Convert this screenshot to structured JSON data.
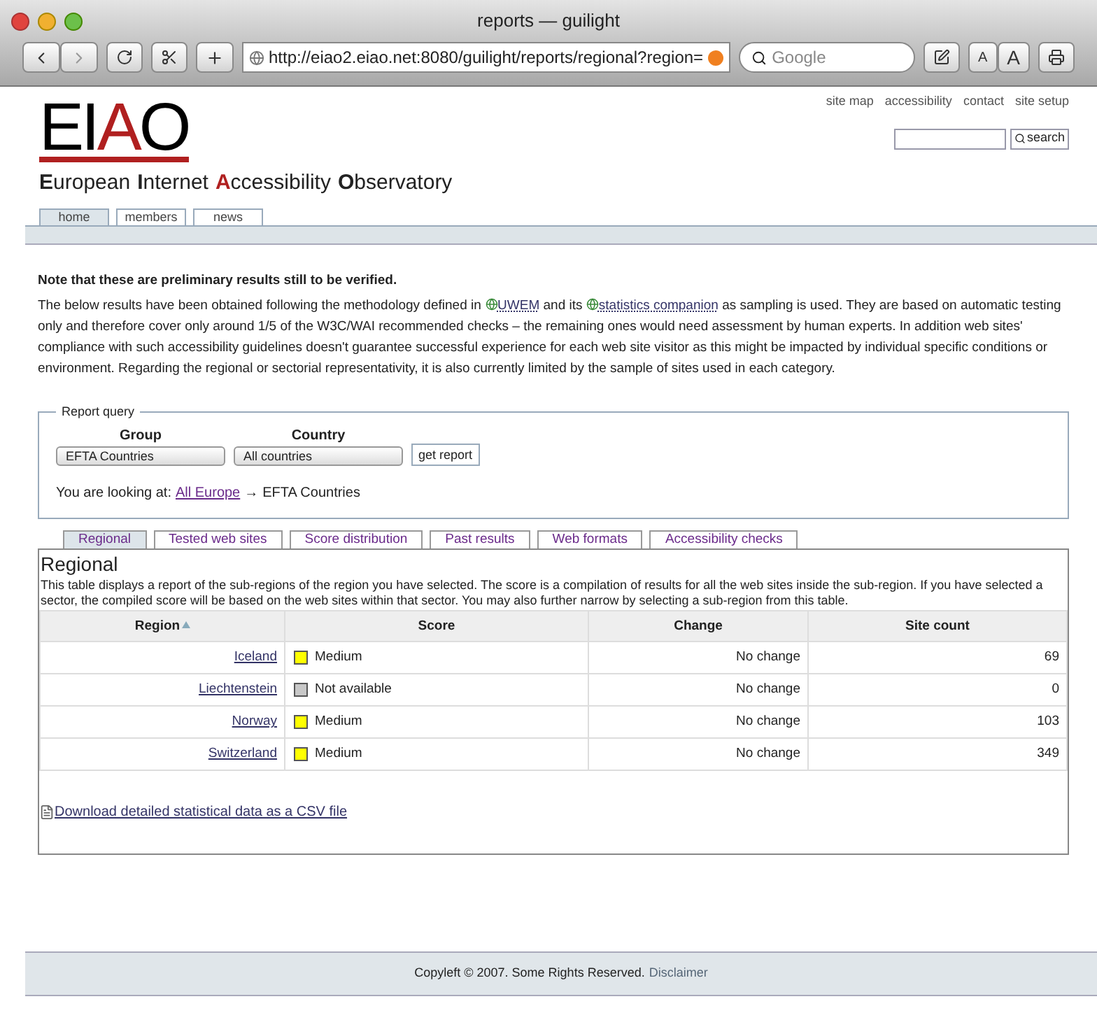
{
  "window": {
    "title": "reports — guilight",
    "url": "http://eiao2.eiao.net:8080/guilight/reports/regional?region=",
    "search_placeholder": "Google",
    "font_buttons": [
      "A",
      "A"
    ]
  },
  "utility_links": [
    "site map",
    "accessibility",
    "contact",
    "site setup"
  ],
  "site_search": {
    "button": "search"
  },
  "logo": {
    "letters": [
      {
        "text": "E",
        "accent": false
      },
      {
        "text": "I",
        "accent": false
      },
      {
        "text": "A",
        "accent": true
      },
      {
        "text": "O",
        "accent": false
      }
    ]
  },
  "subtitle": [
    {
      "initial": "E",
      "rest": "uropean",
      "accent": false
    },
    {
      "initial": "I",
      "rest": "nternet",
      "accent": false
    },
    {
      "initial": "A",
      "rest": "ccessibility",
      "accent": true
    },
    {
      "initial": "O",
      "rest": "bservatory",
      "accent": false
    }
  ],
  "nav_tabs": [
    {
      "label": "home",
      "selected": true
    },
    {
      "label": "members",
      "selected": false
    },
    {
      "label": "news",
      "selected": false
    }
  ],
  "notice": "Note that these are preliminary results still to be verified.",
  "intro": {
    "text_1": "The below results have been obtained following the methodology defined in",
    "link_1": "UWEM",
    "text_2": "and its",
    "link_2": "statistics companion",
    "text_3": "as sampling is used. They are based on automatic testing only and therefore cover only around 1/5 of the W3C/WAI recommended checks – the remaining ones would need assessment by human experts. In addition web sites' compliance with such accessibility guidelines doesn't guarantee successful experience for each web site visitor as this might be impacted by individual specific conditions or environment. Regarding the regional or sectorial representativity, it is also currently limited by the sample of sites used in each category."
  },
  "report_query": {
    "legend": "Report query",
    "group_label": "Group",
    "group_value": "EFTA Countries",
    "country_label": "Country",
    "country_value": "All countries",
    "button": "get report",
    "looking_prefix": "You are looking at:",
    "looking_link": "All Europe",
    "looking_arrow": "→",
    "looking_current": "EFTA Countries"
  },
  "report_tabs": [
    {
      "label": "Regional",
      "selected": true
    },
    {
      "label": "Tested web sites",
      "selected": false
    },
    {
      "label": "Score distribution",
      "selected": false
    },
    {
      "label": "Past results",
      "selected": false
    },
    {
      "label": "Web formats",
      "selected": false
    },
    {
      "label": "Accessibility checks",
      "selected": false
    }
  ],
  "panel": {
    "title": "Regional",
    "description": "This table displays a report of the sub-regions of the region you have selected. The score is a compilation of results for all the web sites inside the sub-region. If you have selected a sector, the compiled score will be based on the web sites within that sector. You may also further narrow by selecting a sub-region from this table."
  },
  "table": {
    "columns": [
      "Region",
      "Score",
      "Change",
      "Site count"
    ],
    "rows": [
      {
        "region": "Iceland",
        "score": "Medium",
        "color": "#ffff00",
        "change": "No change",
        "site_count": "69"
      },
      {
        "region": "Liechtenstein",
        "score": "Not available",
        "color": "#c8c8c8",
        "change": "No change",
        "site_count": "0"
      },
      {
        "region": "Norway",
        "score": "Medium",
        "color": "#ffff00",
        "change": "No change",
        "site_count": "103"
      },
      {
        "region": "Switzerland",
        "score": "Medium",
        "color": "#ffff00",
        "change": "No change",
        "site_count": "349"
      }
    ]
  },
  "download_link": "Download detailed statistical data as a CSV file",
  "footer": {
    "text": "Copyleft © 2007. Some Rights Reserved.",
    "link": "Disclaimer"
  }
}
